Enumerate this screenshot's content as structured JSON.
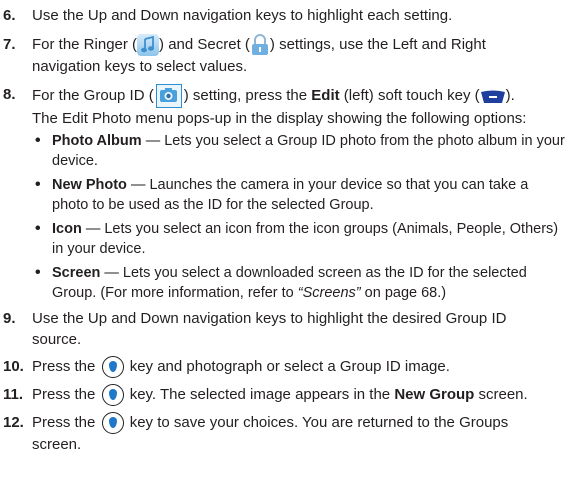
{
  "steps": [
    {
      "num": "6.",
      "line1": "Use the Up and Down navigation keys to highlight each setting."
    },
    {
      "num": "7.",
      "a": "For the Ringer (",
      "b": ") and Secret (",
      "c": ") settings, use the Left and Right",
      "line2": "navigation keys to select values."
    },
    {
      "num": "8.",
      "a": "For the Group ID (",
      "b": ") setting, press the ",
      "bold": "Edit",
      "c": " (left) soft touch key (",
      "d": ").",
      "line2": "The Edit Photo menu pops-up in the display showing the following options:"
    },
    {
      "num": "9.",
      "line1": "Use the Up and Down navigation keys to highlight the desired Group ID",
      "line2": "source."
    },
    {
      "num": "10.",
      "a": "Press the ",
      "b": " key and photograph or select a Group ID image."
    },
    {
      "num": "11.",
      "a": "Press the ",
      "b": " key. The selected image appears in the ",
      "bold": "New Group",
      "c": " screen."
    },
    {
      "num": "12.",
      "a": "Press the ",
      "b": " key to save your choices. You are returned to the Groups",
      "line2": "screen."
    }
  ],
  "options": [
    {
      "title": "Photo Album",
      "text": " — Lets you select a Group ID photo from the photo album in your",
      "line2": "device."
    },
    {
      "title": "New Photo",
      "text": " —  Launches the camera in your device so that you can take a",
      "line2": "photo to be used as the ID for the selected Group."
    },
    {
      "title": "Icon",
      "text": " — Lets you select an icon from the icon groups (Animals, People, Others)",
      "line2": "in your device."
    },
    {
      "title": "Screen",
      "text": " — Lets you select a downloaded screen as the ID for the selected",
      "line2a": "Group. (For more information, refer to ",
      "ref": "“Screens”",
      "line2b": " on page 68.)"
    }
  ],
  "bullet_char": "•",
  "icons": {
    "ok": "ok-key-icon",
    "ringer": "music-note-icon",
    "secret": "lock-icon",
    "group_id": "photo-icon",
    "softkey": "soft-key-icon"
  }
}
